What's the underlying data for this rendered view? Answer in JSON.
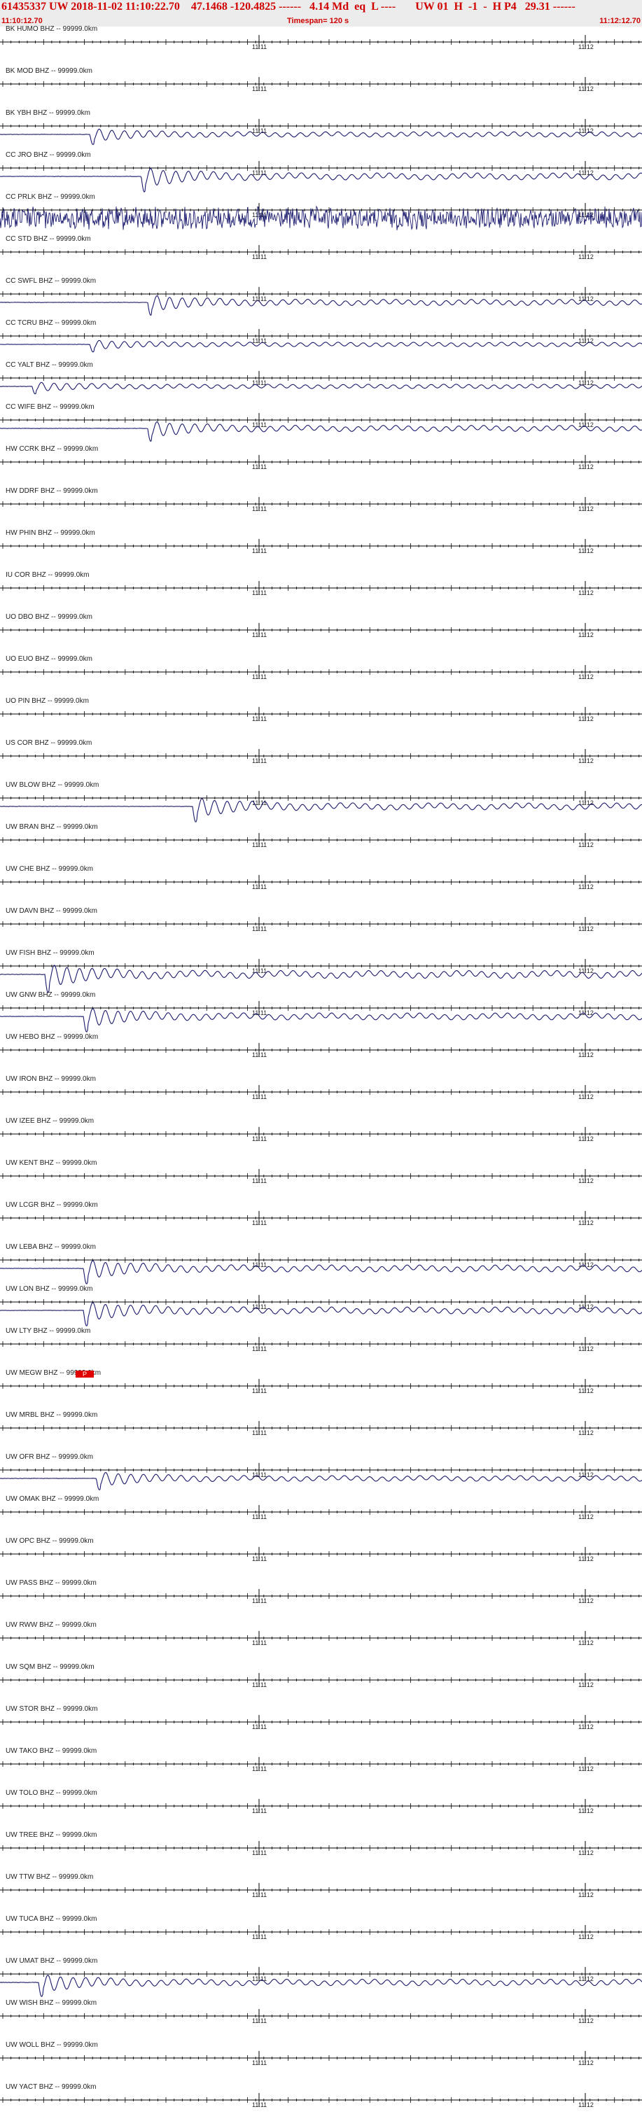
{
  "header": {
    "title": "61435337 UW 2018-11-02 11:10:22.70    47.1468 -120.4825 ------   4.14 Md  eq  L ----       UW 01  H  -1  -  H P4   29.31 ------",
    "start_time": "11:10:12.70",
    "timespan": "Timespan= 120 s",
    "end_time": "11:12:12.70"
  },
  "time_ticks": [
    "11:11",
    "11:12"
  ],
  "pick_marker": {
    "label": "P",
    "color": "#e00000",
    "trace_index": 32
  },
  "colors": {
    "trace": "#1a1a6e",
    "axis": "#000000",
    "header_text": "#d00000"
  },
  "traces": [
    {
      "label": "BK HUMO BHZ -- 99999.0km",
      "amplitude": 0,
      "onset": null
    },
    {
      "label": "BK MOD BHZ -- 99999.0km",
      "amplitude": 0,
      "onset": null
    },
    {
      "label": "BK YBH BHZ -- 99999.0km",
      "amplitude": 0.3,
      "onset": 0.14
    },
    {
      "label": "CC JRO BHZ -- 99999.0km",
      "amplitude": 0.5,
      "onset": 0.22
    },
    {
      "label": "CC PRLK BHZ -- 99999.0km",
      "amplitude": 1.0,
      "onset": 0.0
    },
    {
      "label": "CC STD BHZ -- 99999.0km",
      "amplitude": 0,
      "onset": null
    },
    {
      "label": "CC SWFL BHZ -- 99999.0km",
      "amplitude": 0.4,
      "onset": 0.23
    },
    {
      "label": "CC TCRU BHZ -- 99999.0km",
      "amplitude": 0.2,
      "onset": 0.14
    },
    {
      "label": "CC YALT BHZ -- 99999.0km",
      "amplitude": 0.2,
      "onset": 0.05
    },
    {
      "label": "CC WIFE BHZ -- 99999.0km",
      "amplitude": 0.4,
      "onset": 0.23
    },
    {
      "label": "HW CCRK BHZ -- 99999.0km",
      "amplitude": 0,
      "onset": null
    },
    {
      "label": "HW DDRF BHZ -- 99999.0km",
      "amplitude": 0,
      "onset": null
    },
    {
      "label": "HW PHIN BHZ -- 99999.0km",
      "amplitude": 0,
      "onset": null
    },
    {
      "label": "IU COR BHZ -- 99999.0km",
      "amplitude": 0,
      "onset": null
    },
    {
      "label": "UO DBO BHZ -- 99999.0km",
      "amplitude": 0,
      "onset": null
    },
    {
      "label": "UO EUO BHZ -- 99999.0km",
      "amplitude": 0,
      "onset": null
    },
    {
      "label": "UO PIN BHZ -- 99999.0km",
      "amplitude": 0,
      "onset": null
    },
    {
      "label": "US COR BHZ -- 99999.0km",
      "amplitude": 0,
      "onset": null
    },
    {
      "label": "UW BLOW BHZ -- 99999.0km",
      "amplitude": 0.5,
      "onset": 0.3
    },
    {
      "label": "UW BRAN BHZ -- 99999.0km",
      "amplitude": 0,
      "onset": null
    },
    {
      "label": "UW CHE BHZ -- 99999.0km",
      "amplitude": 0,
      "onset": null
    },
    {
      "label": "UW DAVN BHZ -- 99999.0km",
      "amplitude": 0,
      "onset": null
    },
    {
      "label": "UW FISH BHZ -- 99999.0km",
      "amplitude": 0.6,
      "onset": 0.07
    },
    {
      "label": "UW GNW BHZ -- 99999.0km",
      "amplitude": 0.5,
      "onset": 0.13
    },
    {
      "label": "UW HEBO BHZ -- 99999.0km",
      "amplitude": 0,
      "onset": null
    },
    {
      "label": "UW IRON BHZ -- 99999.0km",
      "amplitude": 0,
      "onset": null
    },
    {
      "label": "UW IZEE BHZ -- 99999.0km",
      "amplitude": 0,
      "onset": null
    },
    {
      "label": "UW KENT BHZ -- 99999.0km",
      "amplitude": 0,
      "onset": null
    },
    {
      "label": "UW LCGR BHZ -- 99999.0km",
      "amplitude": 0,
      "onset": null
    },
    {
      "label": "UW LEBA BHZ -- 99999.0km",
      "amplitude": 0.5,
      "onset": 0.13
    },
    {
      "label": "UW LON BHZ -- 99999.0km",
      "amplitude": 0.5,
      "onset": 0.13
    },
    {
      "label": "UW LTY BHZ -- 99999.0km",
      "amplitude": 0,
      "onset": null
    },
    {
      "label": "UW MEGW BHZ -- 99999.0km",
      "amplitude": 0,
      "onset": null
    },
    {
      "label": "UW MRBL BHZ -- 99999.0km",
      "amplitude": 0,
      "onset": null
    },
    {
      "label": "UW OFR BHZ -- 99999.0km",
      "amplitude": 0.35,
      "onset": 0.15
    },
    {
      "label": "UW OMAK BHZ -- 99999.0km",
      "amplitude": 0,
      "onset": null
    },
    {
      "label": "UW OPC BHZ -- 99999.0km",
      "amplitude": 0,
      "onset": null
    },
    {
      "label": "UW PASS BHZ -- 99999.0km",
      "amplitude": 0,
      "onset": null
    },
    {
      "label": "UW RWW BHZ -- 99999.0km",
      "amplitude": 0,
      "onset": null
    },
    {
      "label": "UW SQM BHZ -- 99999.0km",
      "amplitude": 0,
      "onset": null
    },
    {
      "label": "UW STOR BHZ -- 99999.0km",
      "amplitude": 0,
      "onset": null
    },
    {
      "label": "UW TAKO BHZ -- 99999.0km",
      "amplitude": 0,
      "onset": null
    },
    {
      "label": "UW TOLO BHZ -- 99999.0km",
      "amplitude": 0,
      "onset": null
    },
    {
      "label": "UW TREE BHZ -- 99999.0km",
      "amplitude": 0,
      "onset": null
    },
    {
      "label": "UW TTW BHZ -- 99999.0km",
      "amplitude": 0,
      "onset": null
    },
    {
      "label": "UW TUCA BHZ -- 99999.0km",
      "amplitude": 0,
      "onset": null
    },
    {
      "label": "UW UMAT BHZ -- 99999.0km",
      "amplitude": 0.45,
      "onset": 0.06
    },
    {
      "label": "UW WISH BHZ -- 99999.0km",
      "amplitude": 0,
      "onset": null
    },
    {
      "label": "UW WOLL BHZ -- 99999.0km",
      "amplitude": 0,
      "onset": null
    },
    {
      "label": "UW YACT BHZ -- 99999.0km",
      "amplitude": 0,
      "onset": null
    }
  ]
}
